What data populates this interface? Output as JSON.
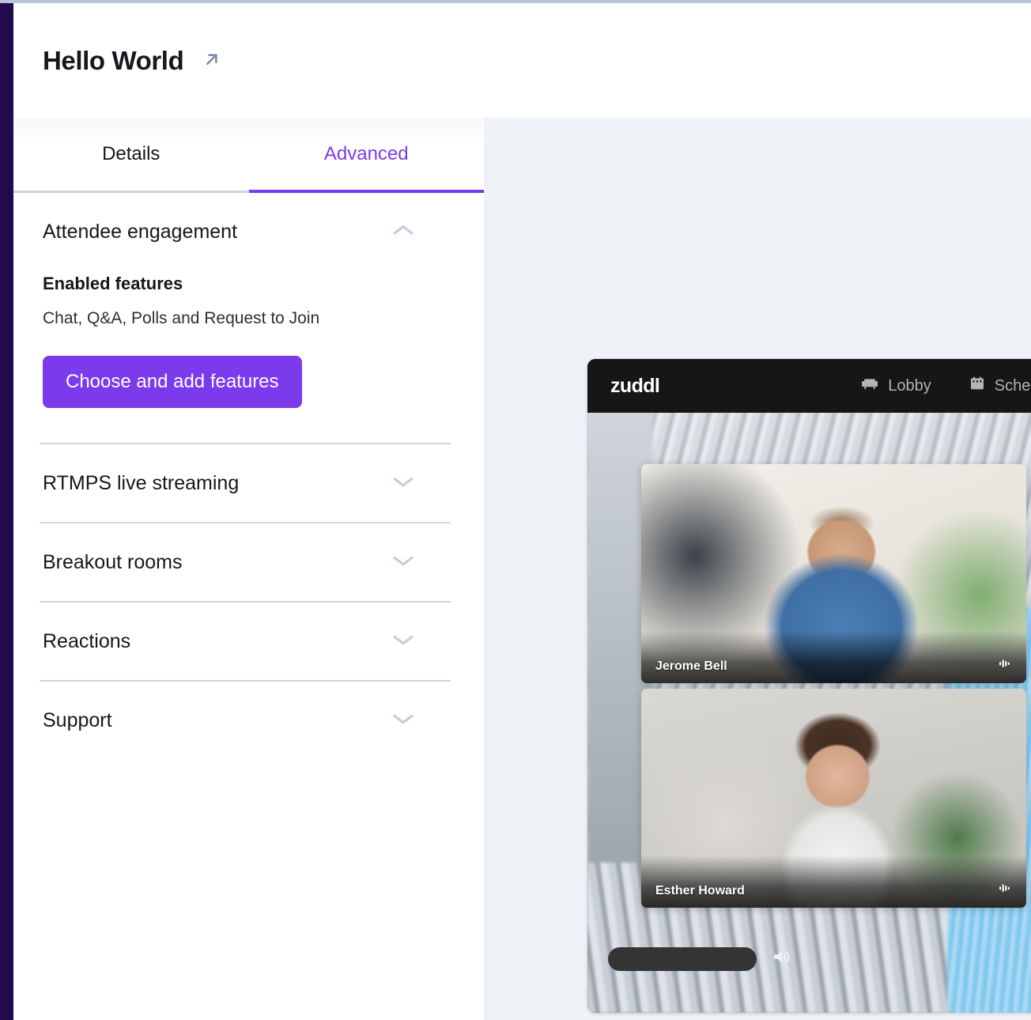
{
  "header": {
    "title": "Hello World",
    "open_link_icon": "arrow-up-right-icon"
  },
  "tabs": [
    {
      "label": "Details",
      "active": false
    },
    {
      "label": "Advanced",
      "active": true
    }
  ],
  "accent_color": "#7c3aed",
  "sections": [
    {
      "title": "Attendee engagement",
      "expanded": true,
      "chevron": "chevron-up-icon",
      "enabled_features_label": "Enabled features",
      "enabled_features_value": "Chat, Q&A, Polls and Request to Join",
      "cta_label": "Choose and add features"
    },
    {
      "title": "RTMPS live streaming",
      "expanded": false,
      "chevron": "chevron-down-icon"
    },
    {
      "title": "Breakout rooms",
      "expanded": false,
      "chevron": "chevron-down-icon"
    },
    {
      "title": "Reactions",
      "expanded": false,
      "chevron": "chevron-down-icon"
    },
    {
      "title": "Support",
      "expanded": false,
      "chevron": "chevron-down-icon"
    }
  ],
  "preview": {
    "logo": "zuddl",
    "nav": [
      {
        "label": "Lobby",
        "icon": "sofa-icon"
      },
      {
        "label": "Schedu",
        "icon": "calendar-icon"
      }
    ],
    "participants": [
      {
        "name": "Jerome Bell",
        "audio_icon": "audio-level-icon"
      },
      {
        "name": "Esther Howard",
        "audio_icon": "audio-level-icon"
      }
    ],
    "controls": {
      "volume_icon": "speaker-volume-icon"
    }
  }
}
